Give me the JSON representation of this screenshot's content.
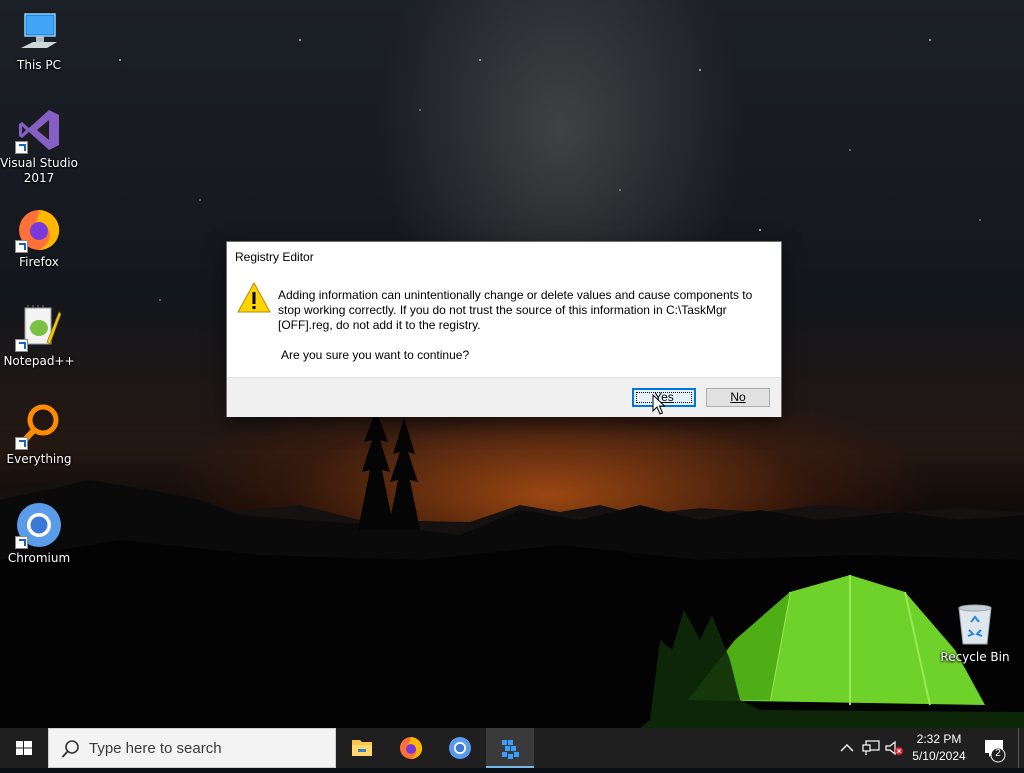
{
  "desktop": {
    "icons": [
      {
        "label": "This PC",
        "icon": "computer-icon"
      },
      {
        "label": "Visual Studio 2017",
        "icon": "visual-studio-icon"
      },
      {
        "label": "Firefox",
        "icon": "firefox-icon"
      },
      {
        "label": "Notepad++",
        "icon": "notepadpp-icon"
      },
      {
        "label": "Everything",
        "icon": "everything-search-icon"
      },
      {
        "label": "Chromium",
        "icon": "chromium-icon"
      },
      {
        "label": "Recycle Bin",
        "icon": "recycle-bin-icon"
      }
    ]
  },
  "dialog": {
    "title": "Registry Editor",
    "icon": "warning-icon",
    "message": "Adding information can unintentionally change or delete values and cause components to stop working correctly. If you do not trust the source of this information in C:\\TaskMgr [OFF].reg, do not add it to the registry.",
    "question": "Are you sure you want to continue?",
    "yes_label": "Yes",
    "no_label": "No",
    "accent": "#0078d7"
  },
  "taskbar": {
    "search_placeholder": "Type here to search",
    "pinned": [
      {
        "name": "File Explorer",
        "icon": "file-explorer-icon"
      },
      {
        "name": "Firefox",
        "icon": "firefox-icon"
      },
      {
        "name": "Chromium",
        "icon": "chromium-icon"
      },
      {
        "name": "Registry Editor",
        "icon": "registry-editor-icon",
        "active": true
      }
    ],
    "time": "2:32 PM",
    "date": "5/10/2024",
    "notification_count": "2"
  }
}
